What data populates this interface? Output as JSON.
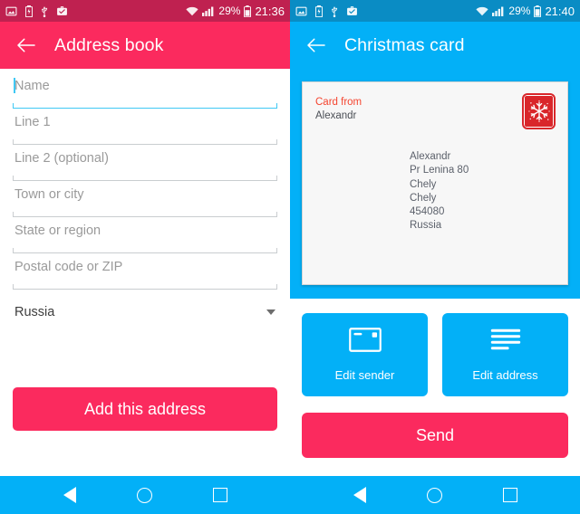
{
  "left_screen": {
    "status_bar": {
      "icons": [
        "image-icon",
        "battery-status-icon",
        "usb-icon",
        "work-profile-icon"
      ],
      "wifi_icon": "wifi-icon",
      "signal_icon": "cellular-signal-icon",
      "battery_percent": "29%",
      "battery_icon": "battery-icon",
      "clock": "21:36"
    },
    "app_bar": {
      "back_icon": "back-arrow-icon",
      "title": "Address book"
    },
    "fields": [
      {
        "placeholder": "Name",
        "value": "",
        "focused": true
      },
      {
        "placeholder": "Line 1",
        "value": "",
        "focused": false
      },
      {
        "placeholder": "Line 2 (optional)",
        "value": "",
        "focused": false
      },
      {
        "placeholder": "Town or city",
        "value": "",
        "focused": false
      },
      {
        "placeholder": "State or region",
        "value": "",
        "focused": false
      },
      {
        "placeholder": "Postal code or ZIP",
        "value": "",
        "focused": false
      }
    ],
    "country_select": {
      "value": "Russia",
      "chevron_icon": "chevron-down-icon"
    },
    "submit_button": "Add this address"
  },
  "right_screen": {
    "status_bar": {
      "icons": [
        "image-icon",
        "battery-status-icon",
        "usb-icon",
        "work-profile-icon"
      ],
      "wifi_icon": "wifi-icon",
      "signal_icon": "cellular-signal-icon",
      "battery_percent": "29%",
      "battery_icon": "battery-icon",
      "clock": "21:40"
    },
    "app_bar": {
      "back_icon": "back-arrow-icon",
      "title": "Christmas card"
    },
    "card_preview": {
      "from_label": "Card from",
      "from_name": "Alexandr",
      "stamp_icon": "snowflake-stamp-icon",
      "address_lines": [
        "Alexandr",
        "Pr Lenina 80",
        "Chely",
        "Chely",
        "454080",
        "Russia"
      ]
    },
    "tiles": [
      {
        "label": "Edit sender",
        "icon": "postcard-icon"
      },
      {
        "label": "Edit address",
        "icon": "address-lines-icon"
      }
    ],
    "send_button": "Send"
  },
  "nav_bar": {
    "back_icon": "nav-back-triangle-icon",
    "home_icon": "nav-home-circle-icon",
    "recents_icon": "nav-recents-square-icon"
  },
  "colors": {
    "pink": "#fb2a5e",
    "pink_dark": "#bf2150",
    "blue": "#03b0f7",
    "blue_dark": "#0a8cc4",
    "field_accent": "#3fc8f4",
    "card_from_red": "#f5442f",
    "stamp_red": "#d9262a"
  }
}
